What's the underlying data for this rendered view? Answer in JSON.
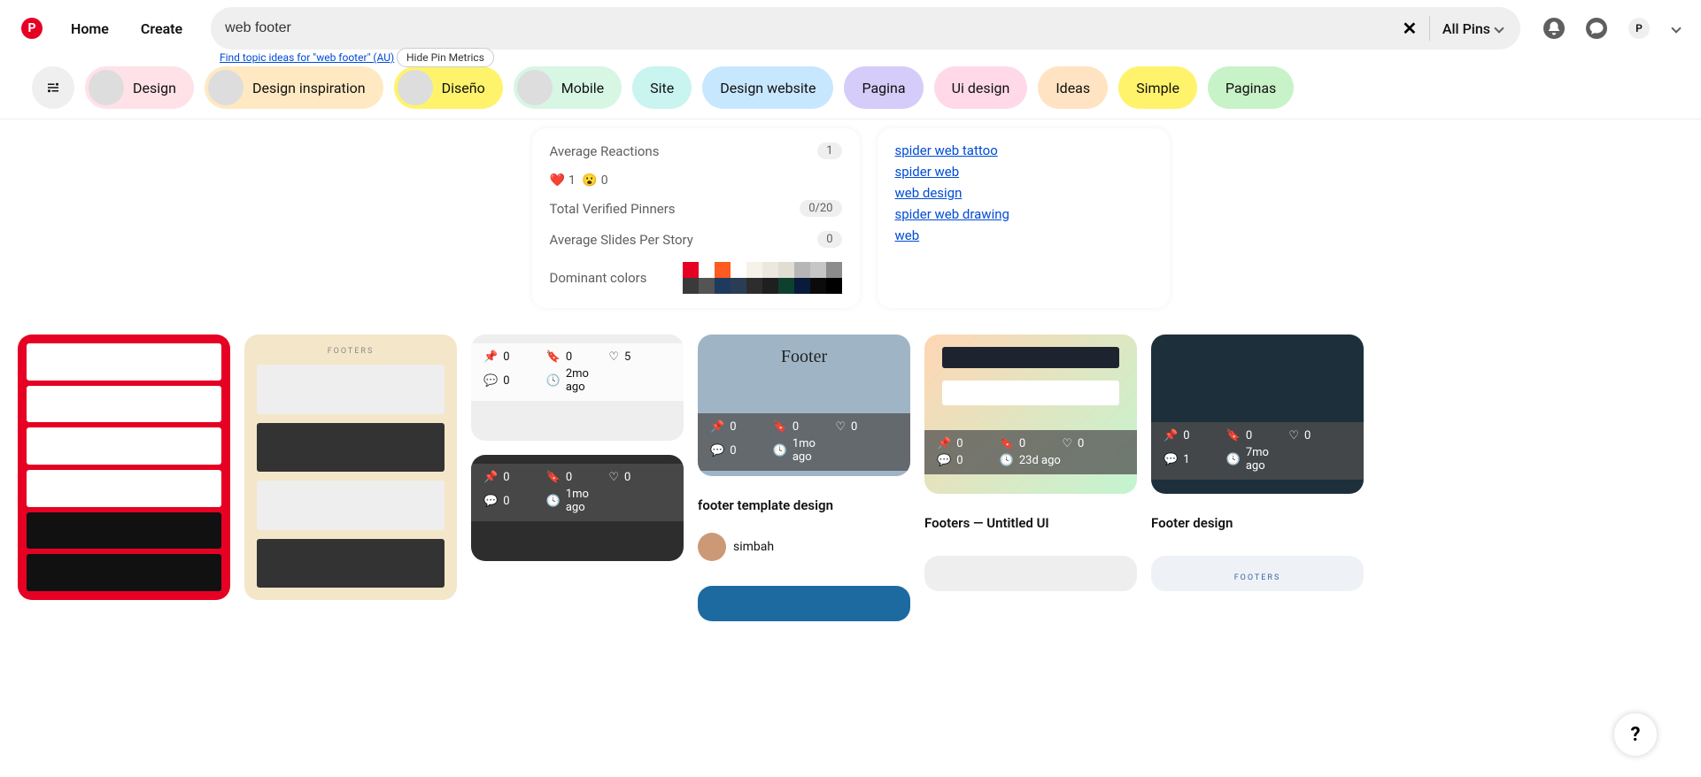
{
  "header": {
    "home": "Home",
    "create": "Create",
    "search_value": "web footer",
    "filter_label": "All Pins",
    "avatar_letter": "P"
  },
  "secbar": {
    "topic_ideas": "Find topic ideas for \"web footer\" (AU)",
    "hide_metrics": "Hide Pin Metrics",
    "pills": [
      {
        "label": "Design",
        "bg": "#ffe1e8",
        "img": true
      },
      {
        "label": "Design inspiration",
        "bg": "#ffe9c2",
        "img": true
      },
      {
        "label": "Diseño",
        "bg": "#fff36b",
        "img": true
      },
      {
        "label": "Mobile",
        "bg": "#d7f6e4",
        "img": true
      },
      {
        "label": "Site",
        "bg": "#c9f4ef",
        "img": false
      },
      {
        "label": "Design website",
        "bg": "#c7e7ff",
        "img": false
      },
      {
        "label": "Pagina",
        "bg": "#d6ccfa",
        "img": false
      },
      {
        "label": "Ui design",
        "bg": "#ffd9e8",
        "img": false
      },
      {
        "label": "Ideas",
        "bg": "#ffe3c2",
        "img": false
      },
      {
        "label": "Simple",
        "bg": "#fff36b",
        "img": false
      },
      {
        "label": "Paginas",
        "bg": "#c8f2c8",
        "img": false
      }
    ]
  },
  "stats": {
    "avg_reactions_label": "Average Reactions",
    "avg_reactions_badge": "1",
    "reaction_heart": "1",
    "reaction_wow": "0",
    "pinners_label": "Total Verified Pinners",
    "pinners_badge": "0/20",
    "slides_label": "Average Slides Per Story",
    "slides_badge": "0",
    "colors_label": "Dominant colors",
    "colors_row1": [
      "#e60023",
      "#ffffff",
      "#ff5a1f",
      "#ffffff",
      "#f5f2ea",
      "#ece8df",
      "#e2ddd3",
      "#b6b6b6",
      "#c6c6c6",
      "#8c8c8c"
    ],
    "colors_row2": [
      "#3a3a3a",
      "#545454",
      "#1e3a5f",
      "#2a3d55",
      "#2d2d2d",
      "#1f1f1f",
      "#0f3f2f",
      "#0a1a3a",
      "#0b0b0b",
      "#000000"
    ]
  },
  "related": {
    "links": [
      "spider web tattoo",
      "spider web",
      "web design",
      "spider web drawing",
      "web"
    ]
  },
  "pins": {
    "p3": {
      "pins": "0",
      "saves": "0",
      "likes": "5",
      "comments": "0",
      "time": "2mo ago"
    },
    "p4": {
      "pins": "0",
      "saves": "0",
      "likes": "0",
      "comments": "0",
      "time": "1mo ago"
    },
    "p5": {
      "title": "footer template design",
      "user": "simbah",
      "pins": "0",
      "saves": "0",
      "likes": "0",
      "comments": "0",
      "time": "1mo ago"
    },
    "p6": {
      "title": "Footers — Untitled UI",
      "pins": "0",
      "saves": "0",
      "likes": "0",
      "comments": "0",
      "time": "23d ago"
    },
    "p7": {
      "title": "Footer design",
      "pins": "0",
      "saves": "0",
      "likes": "0",
      "comments": "1",
      "time": "7mo ago"
    },
    "footer_word": "Footer",
    "footers_word": "FOOTERS"
  },
  "help": "?"
}
